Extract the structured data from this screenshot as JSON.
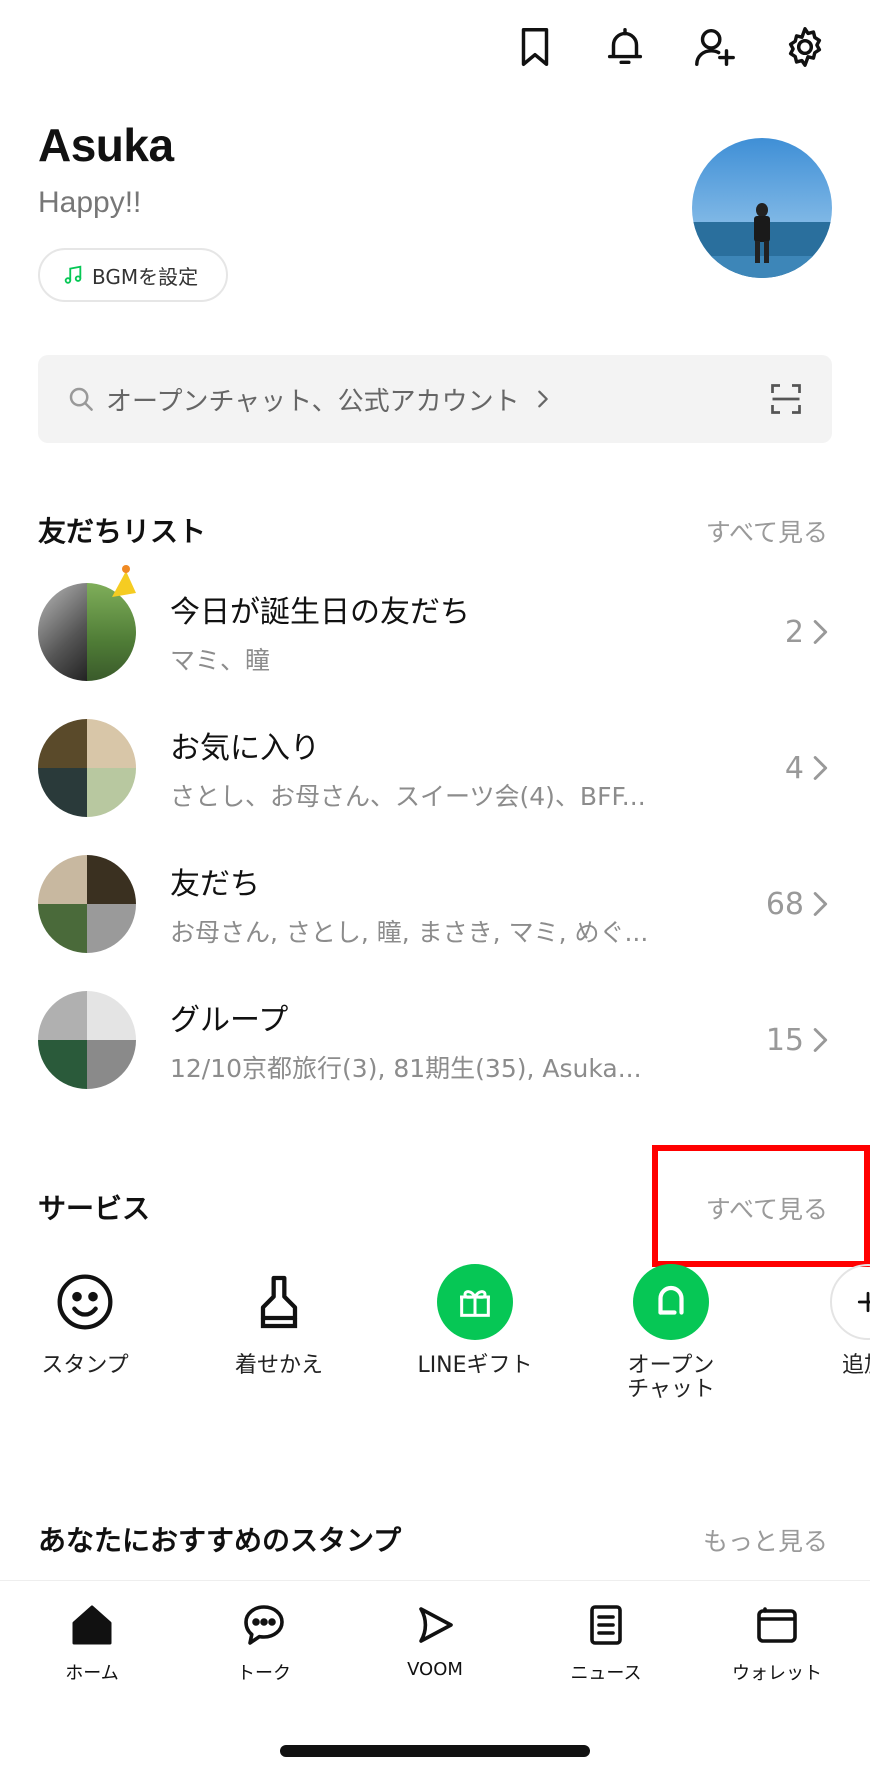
{
  "header": {
    "icons": [
      "bookmark-icon",
      "bell-icon",
      "add-friend-icon",
      "gear-icon"
    ]
  },
  "profile": {
    "name": "Asuka",
    "status": "Happy!!",
    "bgm_label": "BGMを設定"
  },
  "search": {
    "placeholder": "オープンチャット、公式アカウント"
  },
  "friends_section": {
    "title": "友だちリスト",
    "see_all": "すべて見る",
    "rows": [
      {
        "title": "今日が誕生日の友だち",
        "sub": "マミ、瞳",
        "count": "2"
      },
      {
        "title": "お気に入り",
        "sub": "さとし、お母さん、スイーツ会(4)、BFF...",
        "count": "4"
      },
      {
        "title": "友だち",
        "sub": "お母さん, さとし, 瞳, まさき, マミ, めぐ...",
        "count": "68"
      },
      {
        "title": "グループ",
        "sub": "12/10京都旅行(3), 81期生(35), Asuka...",
        "count": "15"
      }
    ]
  },
  "services_section": {
    "title": "サービス",
    "see_all": "すべて見る",
    "items": [
      {
        "label": "スタンプ",
        "icon": "smiley-icon"
      },
      {
        "label": "着せかえ",
        "icon": "brush-icon"
      },
      {
        "label": "LINEギフト",
        "icon": "gift-icon",
        "color": "#06c755"
      },
      {
        "label": "オープン\nチャット",
        "icon": "openchat-icon",
        "color": "#06c755"
      },
      {
        "label": "追加",
        "icon": "plus-icon"
      }
    ]
  },
  "stickers_section": {
    "title": "あなたにおすすめのスタンプ",
    "more": "もっと見る"
  },
  "tabbar": {
    "tabs": [
      {
        "label": "ホーム",
        "icon": "home-icon"
      },
      {
        "label": "トーク",
        "icon": "chat-icon"
      },
      {
        "label": "VOOM",
        "icon": "voom-icon"
      },
      {
        "label": "ニュース",
        "icon": "news-icon"
      },
      {
        "label": "ウォレット",
        "icon": "wallet-icon"
      }
    ]
  },
  "colors": {
    "accent": "#06c755",
    "highlight": "#ff0000"
  }
}
